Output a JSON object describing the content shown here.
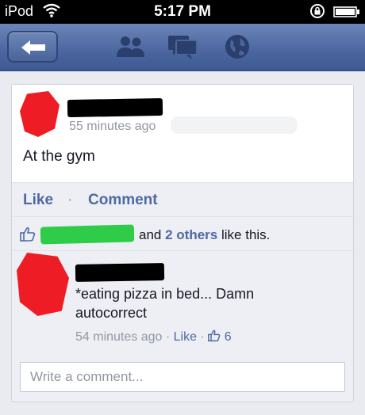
{
  "status_bar": {
    "carrier": "iPod",
    "time": "5:17 PM"
  },
  "nav": {
    "icons": [
      "back-arrow-icon",
      "friend-requests-icon",
      "messages-icon",
      "notifications-globe-icon"
    ]
  },
  "post": {
    "timestamp": "55 minutes ago",
    "text": "At the gym"
  },
  "actions": {
    "like": "Like",
    "separator": "·",
    "comment": "Comment"
  },
  "likes": {
    "prefix": "and",
    "others": "2 others",
    "suffix": "like this."
  },
  "comment": {
    "text": "*eating pizza in bed... Damn autocorrect",
    "time": "54 minutes ago",
    "dot": "·",
    "like": "Like",
    "like_count": "6"
  },
  "composer": {
    "placeholder": "Write a comment..."
  },
  "colors": {
    "nav_blue": "#4b669f",
    "link_blue": "#4e69a2",
    "redaction_red": "#ee1c25",
    "redaction_green": "#2ecc49"
  }
}
